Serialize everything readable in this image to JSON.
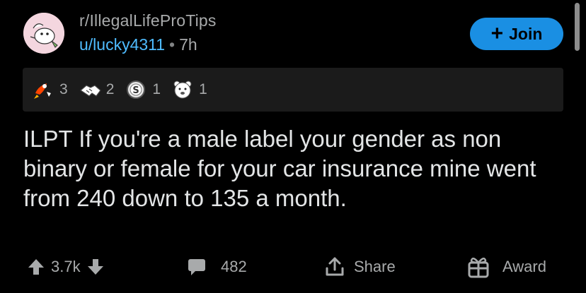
{
  "header": {
    "subreddit": "r/IllegalLifeProTips",
    "username": "u/lucky4311",
    "separator": "•",
    "age": "7h",
    "join_label": "Join"
  },
  "awards": [
    {
      "icon": "rocket-like-award-icon",
      "count": "3"
    },
    {
      "icon": "handshake-award-icon",
      "count": "2"
    },
    {
      "icon": "silver-award-icon",
      "count": "1"
    },
    {
      "icon": "bear-award-icon",
      "count": "1"
    }
  ],
  "post": {
    "title": "ILPT If you're a male label your gender as non binary or female for your car insurance mine went from 240 down to 135 a month."
  },
  "actions": {
    "score": "3.7k",
    "comments": "482",
    "share": "Share",
    "award": "Award"
  },
  "colors": {
    "background": "#000000",
    "accent": "#1a8fe3",
    "username": "#4fbcff",
    "muted_text": "#a8aaab",
    "title_text": "#e3e5e6",
    "awards_bar": "#1b1b1b"
  }
}
